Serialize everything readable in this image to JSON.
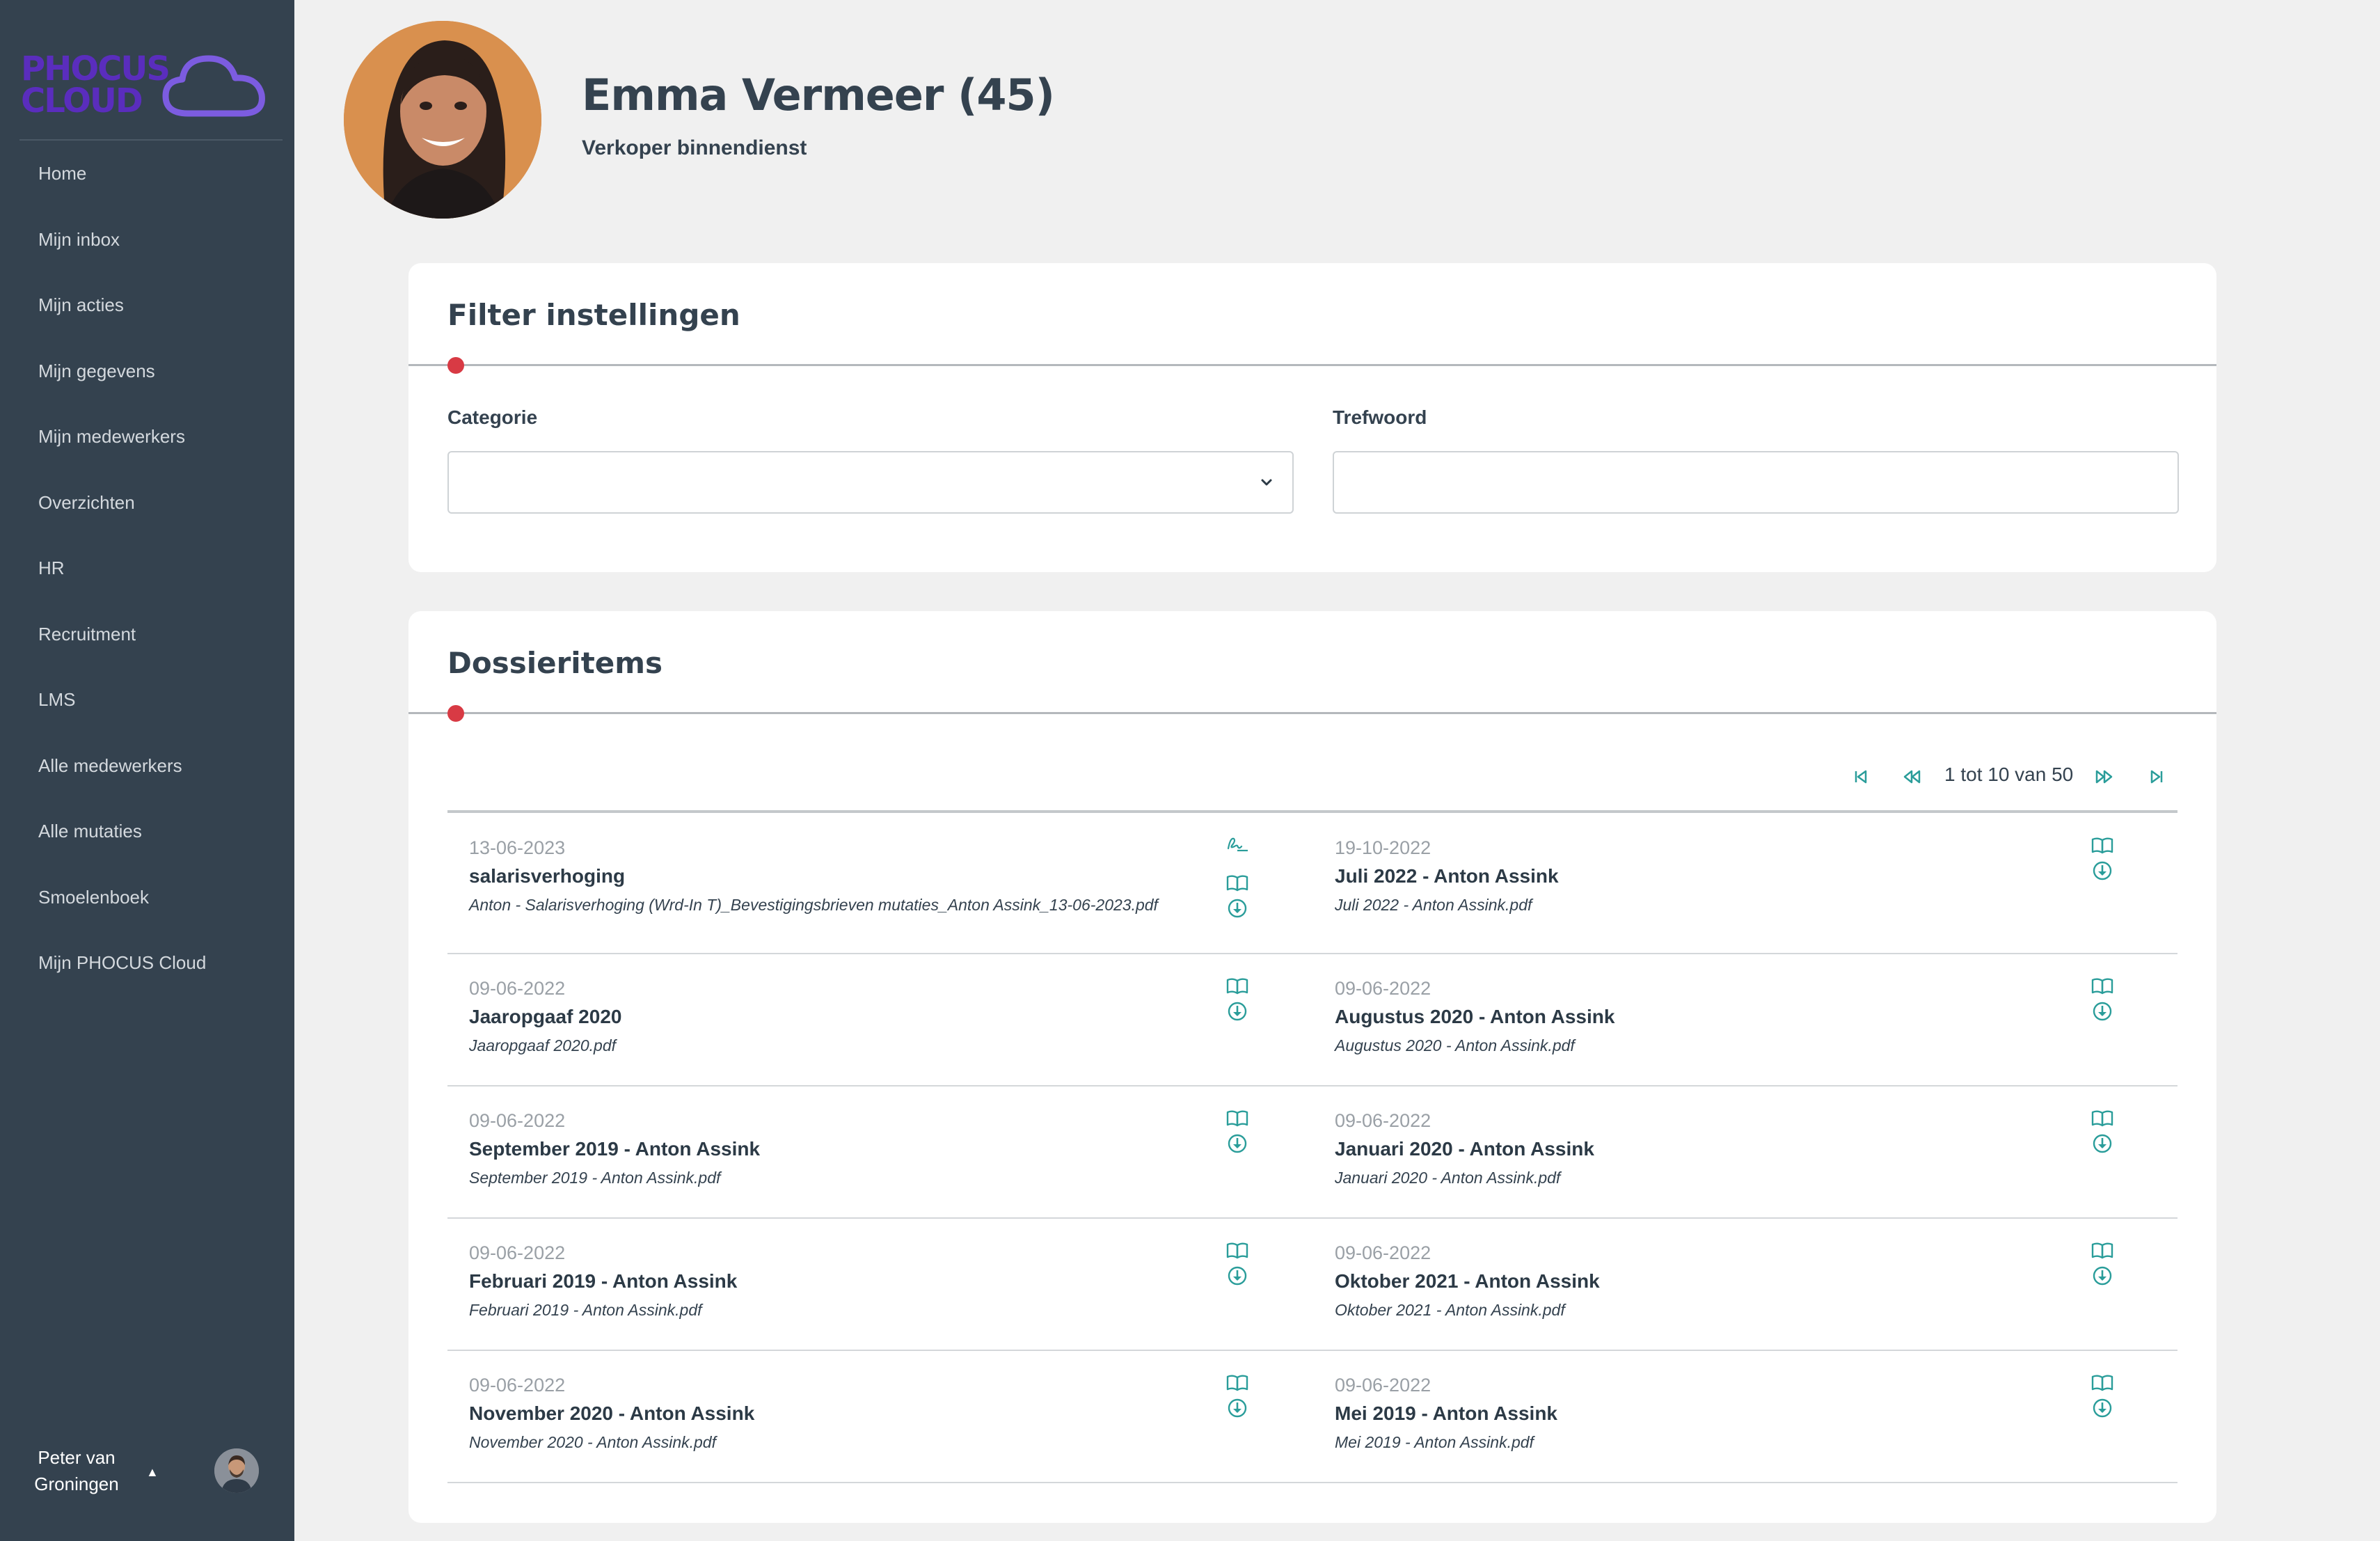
{
  "sidebar": {
    "logo_line1": "PHOCUS",
    "logo_line2": "CLOUD",
    "items": [
      {
        "label": "Home"
      },
      {
        "label": "Mijn inbox"
      },
      {
        "label": "Mijn acties"
      },
      {
        "label": "Mijn gegevens"
      },
      {
        "label": "Mijn medewerkers"
      },
      {
        "label": "Overzichten"
      },
      {
        "label": "HR"
      },
      {
        "label": "Recruitment"
      },
      {
        "label": "LMS"
      },
      {
        "label": "Alle medewerkers"
      },
      {
        "label": "Alle mutaties"
      },
      {
        "label": "Smoelenboek"
      },
      {
        "label": "Mijn PHOCUS Cloud"
      }
    ],
    "user_name_line1": "Peter van",
    "user_name_line2": "Groningen",
    "user_caret": "▲"
  },
  "profile": {
    "name": "Emma Vermeer (45)",
    "role": "Verkoper binnendienst"
  },
  "filter": {
    "title": "Filter instellingen",
    "categorie_label": "Categorie",
    "categorie_value": "",
    "trefwoord_label": "Trefwoord",
    "trefwoord_value": ""
  },
  "dossier": {
    "title": "Dossieritems",
    "pager_text": "1 tot 10 van 50",
    "items": [
      {
        "date": "13-06-2023",
        "title": "salarisverhoging",
        "file": "Anton - Salarisverhoging (Wrd-In T)_Bevestigingsbrieven mutaties_Anton Assink_13-06-2023.pdf",
        "sign": true
      },
      {
        "date": "19-10-2022",
        "title": "Juli 2022 - Anton Assink",
        "file": "Juli 2022 - Anton Assink.pdf",
        "sign": false
      },
      {
        "date": "09-06-2022",
        "title": "Jaaropgaaf 2020",
        "file": "Jaaropgaaf 2020.pdf",
        "sign": false
      },
      {
        "date": "09-06-2022",
        "title": "Augustus 2020 - Anton Assink",
        "file": "Augustus 2020 - Anton Assink.pdf",
        "sign": false
      },
      {
        "date": "09-06-2022",
        "title": "September 2019 - Anton Assink",
        "file": "September 2019 - Anton Assink.pdf",
        "sign": false
      },
      {
        "date": "09-06-2022",
        "title": "Januari 2020 - Anton Assink",
        "file": "Januari 2020 - Anton Assink.pdf",
        "sign": false
      },
      {
        "date": "09-06-2022",
        "title": "Februari 2019 - Anton Assink",
        "file": "Februari 2019 - Anton Assink.pdf",
        "sign": false
      },
      {
        "date": "09-06-2022",
        "title": "Oktober 2021 - Anton Assink",
        "file": "Oktober 2021 - Anton Assink.pdf",
        "sign": false
      },
      {
        "date": "09-06-2022",
        "title": "November 2020 - Anton Assink",
        "file": "November 2020 - Anton Assink.pdf",
        "sign": false
      },
      {
        "date": "09-06-2022",
        "title": "Mei 2019 - Anton Assink",
        "file": "Mei 2019 - Anton Assink.pdf",
        "sign": false
      }
    ]
  },
  "colors": {
    "sidebar": "#34424f",
    "accent_dot": "#d83a44",
    "icon_teal": "#2a9d9a",
    "logo_purple": "#5a2dbd"
  }
}
